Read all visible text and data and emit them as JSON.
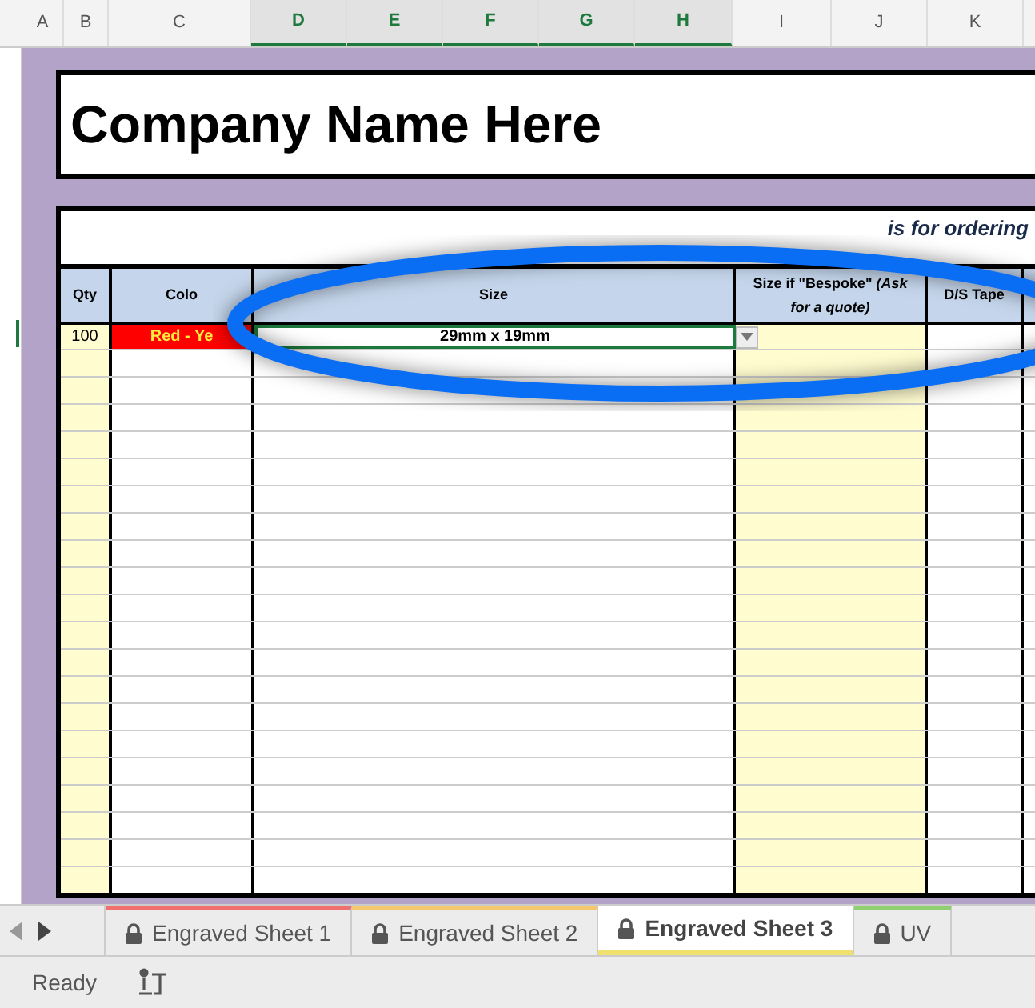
{
  "column_letters": [
    {
      "label": "A",
      "selected": false
    },
    {
      "label": "B",
      "selected": false
    },
    {
      "label": "C",
      "selected": false
    },
    {
      "label": "D",
      "selected": true
    },
    {
      "label": "E",
      "selected": true
    },
    {
      "label": "F",
      "selected": true
    },
    {
      "label": "G",
      "selected": true
    },
    {
      "label": "H",
      "selected": true
    },
    {
      "label": "I",
      "selected": false
    },
    {
      "label": "J",
      "selected": false
    },
    {
      "label": "K",
      "selected": false
    }
  ],
  "title": "Company Name Here",
  "note": "is for ordering",
  "table": {
    "columns": [
      "Qty",
      "Colo",
      "Size",
      "Size if \"Bespoke\" *(Ask for a quote)*",
      "D/S Tape"
    ],
    "rows": [
      {
        "qty": "100",
        "colour": "Red - Ye",
        "size": "29mm x 19mm",
        "size_selected": true
      }
    ]
  },
  "sheet_tabs": [
    {
      "label": "Engraved Sheet 1",
      "color": "#f07070",
      "selected": false
    },
    {
      "label": "Engraved Sheet 2",
      "color": "#f5c870",
      "selected": false
    },
    {
      "label": "Engraved Sheet 3",
      "color": "#f0e070",
      "selected": true
    },
    {
      "label": "UV",
      "color": "#8fcf70",
      "selected": false
    }
  ],
  "status_bar": {
    "text": "Ready"
  }
}
